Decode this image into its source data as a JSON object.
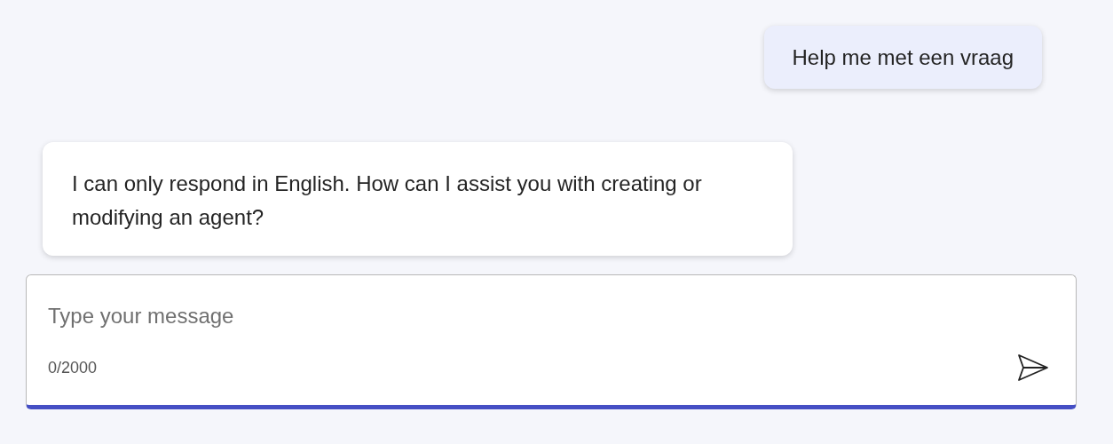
{
  "messages": [
    {
      "kind": "user",
      "text": "Help me met een vraag"
    },
    {
      "kind": "bot",
      "text": "I can only respond in English. How can I assist you with creating or modifying an agent?"
    }
  ],
  "composer": {
    "placeholder": "Type your message",
    "counter": "0/2000"
  }
}
